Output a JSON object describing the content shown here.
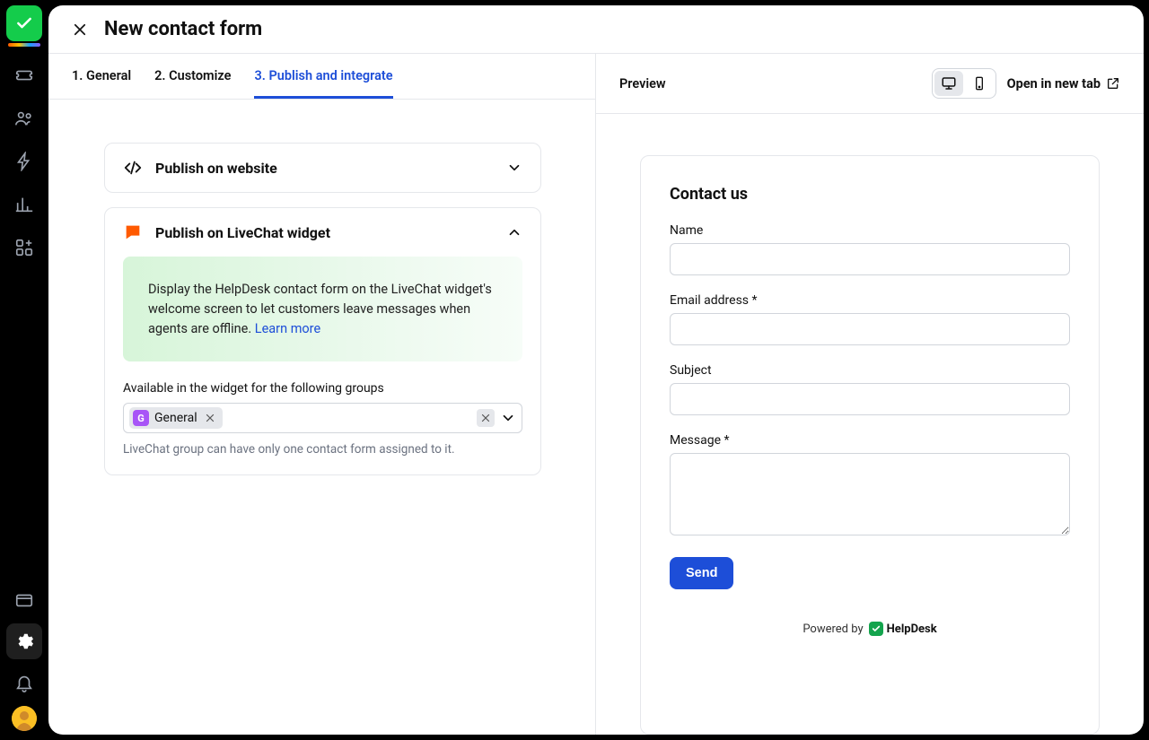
{
  "header": {
    "title": "New contact form"
  },
  "tabs": [
    {
      "label": "1. General",
      "active": false
    },
    {
      "label": "2. Customize",
      "active": false
    },
    {
      "label": "3. Publish and integrate",
      "active": true
    }
  ],
  "publish_website": {
    "title": "Publish on website"
  },
  "publish_livechat": {
    "title": "Publish on LiveChat widget",
    "info_text": "Display the HelpDesk contact form on the LiveChat widget's welcome screen to let customers leave messages when agents are offline. ",
    "learn_more": "Learn more",
    "groups_label": "Available in the widget for the following groups",
    "chip_label": "General",
    "chip_badge": "G",
    "hint": "LiveChat group can have only one contact form assigned to it."
  },
  "right": {
    "preview_label": "Preview",
    "open_new_tab": "Open in new tab"
  },
  "preview": {
    "heading": "Contact us",
    "fields": {
      "name": "Name",
      "email": "Email address *",
      "subject": "Subject",
      "message": "Message *"
    },
    "send": "Send",
    "powered_by": "Powered by",
    "brand": "HelpDesk"
  }
}
